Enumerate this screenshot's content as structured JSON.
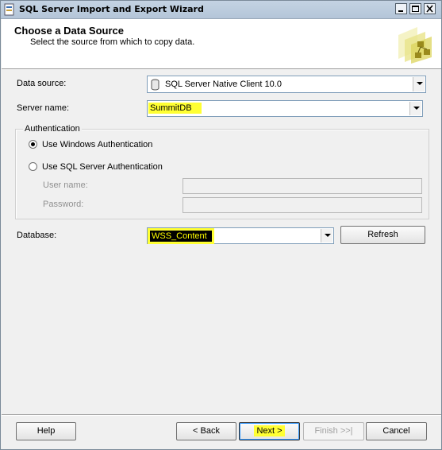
{
  "window": {
    "title": "SQL Server Import and Export Wizard"
  },
  "header": {
    "title": "Choose a Data Source",
    "subtitle": "Select the source from which to copy data."
  },
  "form": {
    "data_source_label": "Data source:",
    "data_source_value": "SQL Server Native Client 10.0",
    "server_name_label": "Server name:",
    "server_name_value": "SummitDB",
    "authentication": {
      "legend": "Authentication",
      "windows_auth_label": "Use Windows Authentication",
      "sql_auth_label": "Use SQL Server Authentication",
      "selected": "windows",
      "user_name_label": "User name:",
      "user_name_value": "",
      "password_label": "Password:",
      "password_value": ""
    },
    "database_label": "Database:",
    "database_value": "WSS_Content",
    "refresh_label": "Refresh"
  },
  "footer": {
    "help_label": "Help",
    "back_label": "< Back",
    "next_label": "Next >",
    "finish_label": "Finish >>|",
    "cancel_label": "Cancel"
  },
  "icons": {
    "app": "wizard-app-icon",
    "header": "data-flow-wizard-icon",
    "data_source": "database-provider-icon"
  },
  "colors": {
    "highlight": "#ffff33",
    "focus_blue": "#3399ff"
  }
}
